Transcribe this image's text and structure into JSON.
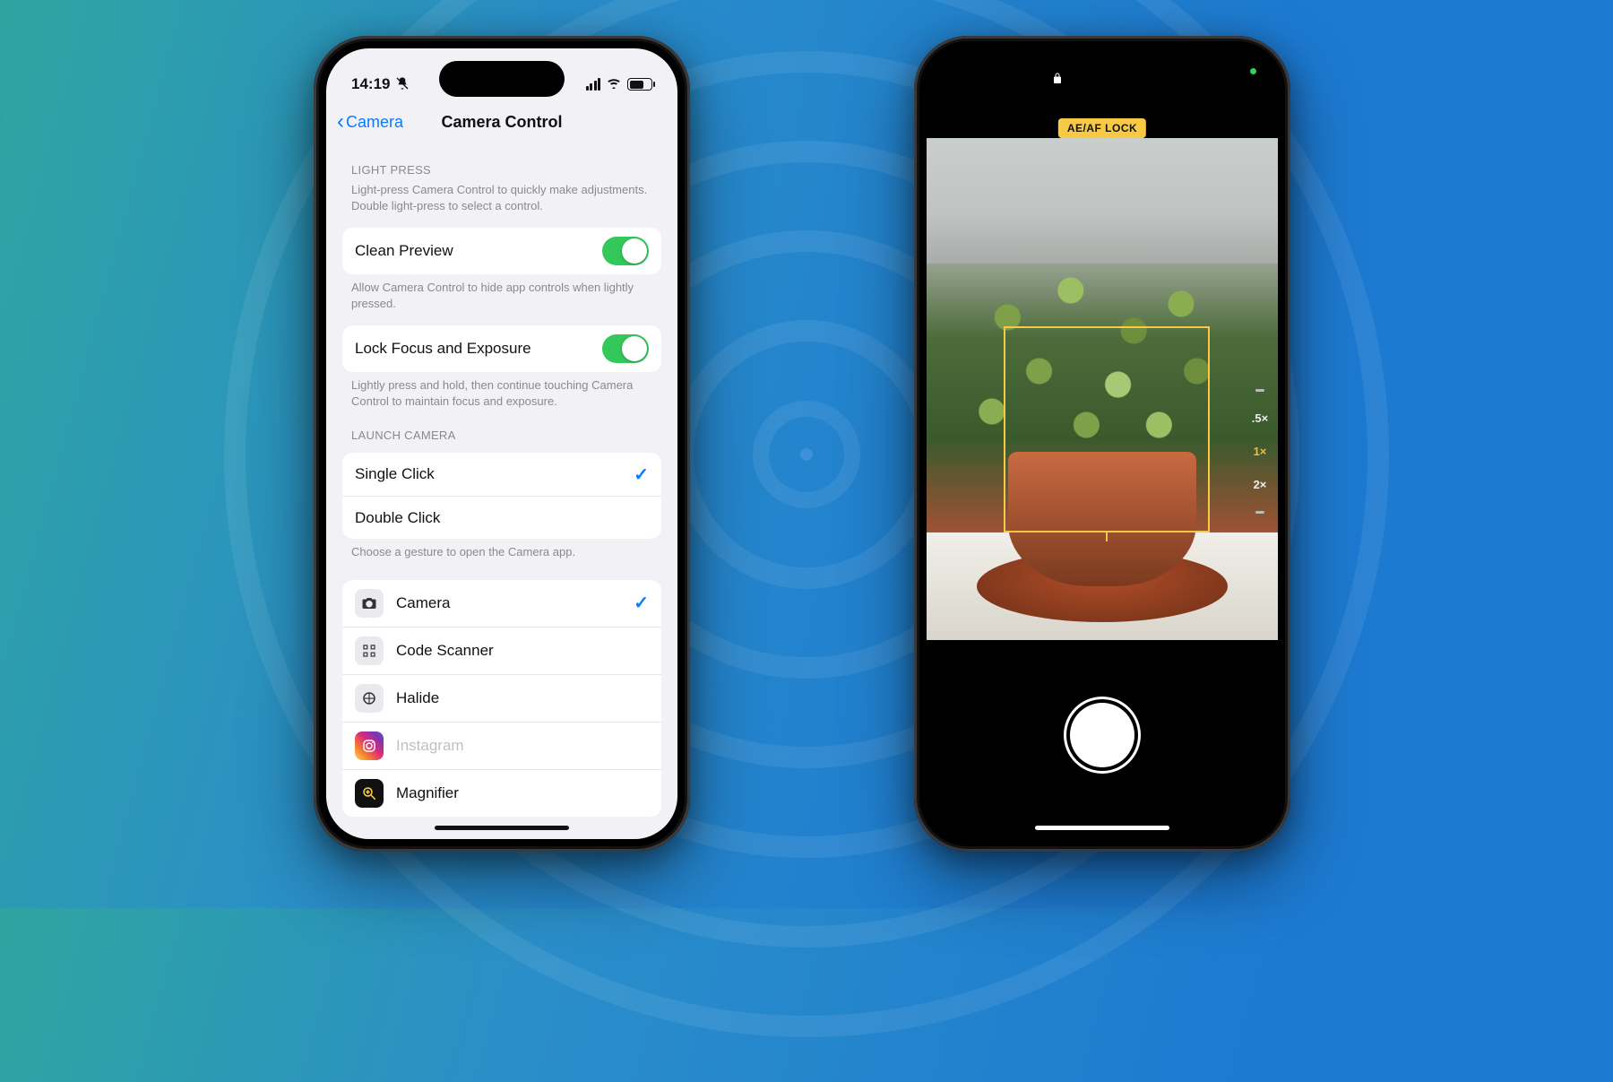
{
  "statusbar": {
    "time": "14:19",
    "silent_icon": "bell-slash-icon"
  },
  "nav": {
    "back_label": "Camera",
    "title": "Camera Control"
  },
  "sections": {
    "light_press": {
      "header": "LIGHT PRESS",
      "description": "Light-press Camera Control to quickly make adjustments. Double light-press to select a control."
    },
    "clean_preview": {
      "label": "Clean Preview",
      "on": true,
      "footer": "Allow Camera Control to hide app controls when lightly pressed."
    },
    "lock_focus": {
      "label": "Lock Focus and Exposure",
      "on": true,
      "footer": "Lightly press and hold, then continue touching Camera Control to maintain focus and exposure."
    },
    "launch_camera": {
      "header": "LAUNCH CAMERA",
      "options": [
        {
          "label": "Single Click",
          "selected": true
        },
        {
          "label": "Double Click",
          "selected": false
        }
      ],
      "footer": "Choose a gesture to open the Camera app."
    },
    "apps": [
      {
        "label": "Camera",
        "selected": true,
        "icon": "camera"
      },
      {
        "label": "Code Scanner",
        "selected": false,
        "icon": "scanner"
      },
      {
        "label": "Halide",
        "selected": false,
        "icon": "halide"
      },
      {
        "label": "Instagram",
        "selected": false,
        "icon": "instagram",
        "disabled": true
      },
      {
        "label": "Magnifier",
        "selected": false,
        "icon": "magnifier"
      }
    ]
  },
  "camera_preview": {
    "badge": "AE/AF LOCK",
    "zoom_levels": [
      ".5×",
      "1×",
      "2×"
    ],
    "zoom_selected": "1×"
  },
  "colors": {
    "ios_blue": "#0a7aff",
    "ios_green": "#34c759",
    "badge_yellow": "#f7c945"
  }
}
